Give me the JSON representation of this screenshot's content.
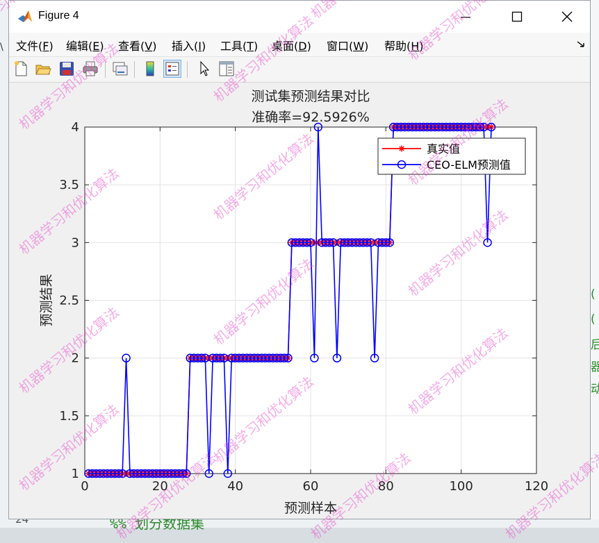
{
  "window": {
    "title": "Figure 4"
  },
  "menu": [
    {
      "label": "文件(",
      "key": "F",
      "tail": ")"
    },
    {
      "label": "编辑(",
      "key": "E",
      "tail": ")"
    },
    {
      "label": "查看(",
      "key": "V",
      "tail": ")"
    },
    {
      "label": "插入(",
      "key": "I",
      "tail": ")"
    },
    {
      "label": "工具(",
      "key": "T",
      "tail": ")"
    },
    {
      "label": "桌面(",
      "key": "D",
      "tail": ")"
    },
    {
      "label": "窗口(",
      "key": "W",
      "tail": ")"
    },
    {
      "label": "帮助(",
      "key": "H",
      "tail": ")"
    }
  ],
  "toolbar": {
    "icons": [
      "new-figure-icon",
      "open-file-icon",
      "save-icon",
      "print-icon",
      "link-plot-icon",
      "colorbar-icon",
      "legend-icon",
      "pointer-icon",
      "property-inspector-icon"
    ]
  },
  "background": {
    "right_chars": [
      "(",
      "(",
      "后",
      "器",
      "动"
    ],
    "bottom_line_num": "24",
    "bottom_comment": "%%  划分数据集"
  },
  "watermark": "机器学习和优化算法",
  "chart_data": {
    "type": "line",
    "title": "测试集预测结果对比",
    "subtitle": "准确率=92.5926%",
    "xlabel": "预测样本",
    "ylabel": "预测结果",
    "xlim": [
      0,
      120
    ],
    "ylim": [
      1,
      4
    ],
    "xticks": [
      0,
      20,
      40,
      60,
      80,
      100,
      120
    ],
    "yticks": [
      1,
      1.5,
      2,
      2.5,
      3,
      3.5,
      4
    ],
    "grid": true,
    "legend_position": "top-right",
    "series": [
      {
        "name": "真实值",
        "color": "#ff0000",
        "marker": "star",
        "values": [
          1,
          1,
          1,
          1,
          1,
          1,
          1,
          1,
          1,
          1,
          1,
          1,
          1,
          1,
          1,
          1,
          1,
          1,
          1,
          1,
          1,
          1,
          1,
          1,
          1,
          1,
          1,
          2,
          2,
          2,
          2,
          2,
          2,
          2,
          2,
          2,
          2,
          2,
          2,
          2,
          2,
          2,
          2,
          2,
          2,
          2,
          2,
          2,
          2,
          2,
          2,
          2,
          2,
          2,
          3,
          3,
          3,
          3,
          3,
          3,
          3,
          3,
          3,
          3,
          3,
          3,
          3,
          3,
          3,
          3,
          3,
          3,
          3,
          3,
          3,
          3,
          3,
          3,
          3,
          3,
          3,
          4,
          4,
          4,
          4,
          4,
          4,
          4,
          4,
          4,
          4,
          4,
          4,
          4,
          4,
          4,
          4,
          4,
          4,
          4,
          4,
          4,
          4,
          4,
          4,
          4,
          4,
          4
        ]
      },
      {
        "name": "CEO-ELM预测值",
        "color": "#0000ff",
        "marker": "circle",
        "values": [
          1,
          1,
          1,
          1,
          1,
          1,
          1,
          1,
          1,
          1,
          2,
          1,
          1,
          1,
          1,
          1,
          1,
          1,
          1,
          1,
          1,
          1,
          1,
          1,
          1,
          1,
          1,
          2,
          2,
          2,
          2,
          2,
          1,
          2,
          2,
          2,
          2,
          1,
          2,
          2,
          2,
          2,
          2,
          2,
          2,
          2,
          2,
          2,
          2,
          2,
          2,
          2,
          2,
          2,
          3,
          3,
          3,
          3,
          3,
          3,
          2,
          4,
          3,
          3,
          3,
          3,
          2,
          3,
          3,
          3,
          3,
          3,
          3,
          3,
          3,
          3,
          2,
          3,
          3,
          3,
          3,
          4,
          4,
          4,
          4,
          4,
          4,
          4,
          4,
          4,
          4,
          4,
          4,
          4,
          4,
          4,
          4,
          4,
          4,
          4,
          4,
          4,
          4,
          4,
          4,
          4,
          3,
          4
        ]
      }
    ]
  }
}
